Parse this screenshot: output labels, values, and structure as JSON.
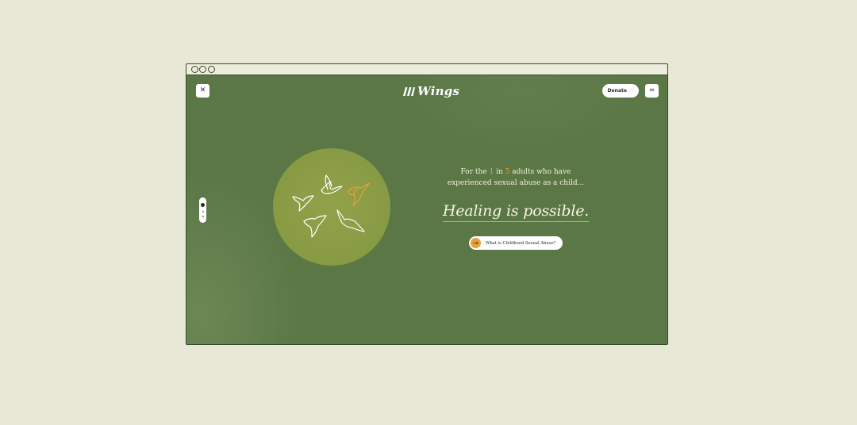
{
  "header": {
    "close_label": "✕",
    "logo_text": "Wings",
    "donate_label": "Donate",
    "donate_icon": "heart-icon",
    "menu_icon": "hamburger-icon",
    "menu_glyph": "="
  },
  "hero": {
    "intro_part1": "For the ",
    "intro_num1": "1",
    "intro_part2": " in ",
    "intro_num2": "5",
    "intro_part3": " adults who have",
    "intro_line2": "experienced sexual abuse as a child...",
    "headline": "Healing is possible.",
    "cta_label": "What is Childhood Sexual Abuse?",
    "cta_icon": "arrow-right-icon"
  },
  "colors": {
    "page_background": "#e7e8d6",
    "site_green": "#5b7746",
    "circle_olive": "#8b9c46",
    "accent_orange": "#e8a23a",
    "text_cream": "#f2f0dc"
  }
}
